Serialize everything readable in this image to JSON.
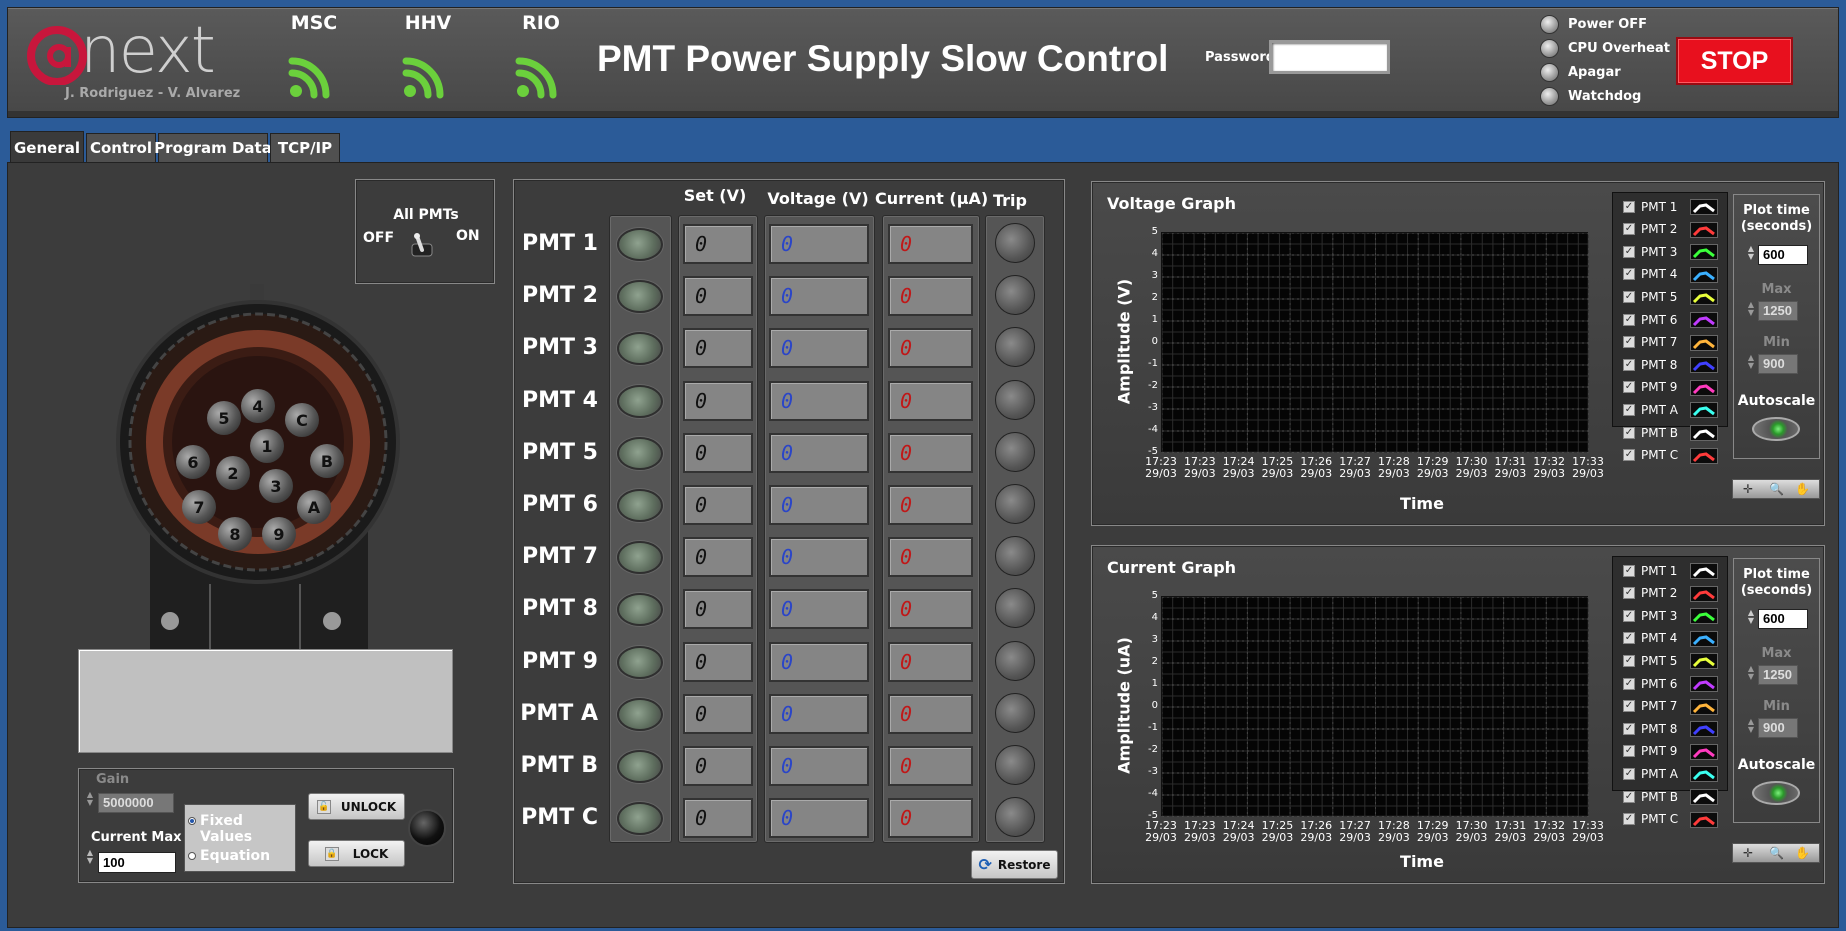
{
  "header": {
    "logo_text": "next",
    "authors": "J. Rodriguez  - V. Alvarez",
    "network": [
      "MSC",
      "HHV",
      "RIO"
    ],
    "title": "PMT Power Supply Slow Control",
    "password_label": "Password",
    "password_value": "",
    "status": [
      "Power OFF",
      "CPU Overheat",
      "Apagar",
      "Watchdog"
    ],
    "stop_label": "STOP",
    "colors": {
      "wifi": "#6bd03c",
      "stop": "#e8101e",
      "logo": "#c8163c"
    }
  },
  "tabs": [
    "General",
    "Control",
    "Program Data",
    "TCP/IP"
  ],
  "active_tab": "General",
  "all_pmts": {
    "title": "All PMTs",
    "off": "OFF",
    "on": "ON"
  },
  "pmt_numbers": [
    "1",
    "2",
    "3",
    "4",
    "5",
    "6",
    "7",
    "8",
    "9",
    "A",
    "B",
    "C"
  ],
  "gain": {
    "label": "Gain",
    "value": "5000000",
    "current_max_label": "Current Max",
    "current_max_value": "100",
    "fixed_values": "Fixed Values",
    "equation": "Equation",
    "selected": "Fixed Values",
    "unlock": "UNLOCK",
    "lock": "LOCK"
  },
  "pmt_table": {
    "headers": {
      "set": "Set (V)",
      "voltage": "Voltage (V)",
      "current": "Current  (µA)",
      "trip": "Trip"
    },
    "rows": [
      {
        "label": "PMT 1",
        "set": "0",
        "voltage": "0",
        "current": "0"
      },
      {
        "label": "PMT 2",
        "set": "0",
        "voltage": "0",
        "current": "0"
      },
      {
        "label": "PMT 3",
        "set": "0",
        "voltage": "0",
        "current": "0"
      },
      {
        "label": "PMT 4",
        "set": "0",
        "voltage": "0",
        "current": "0"
      },
      {
        "label": "PMT 5",
        "set": "0",
        "voltage": "0",
        "current": "0"
      },
      {
        "label": "PMT 6",
        "set": "0",
        "voltage": "0",
        "current": "0"
      },
      {
        "label": "PMT 7",
        "set": "0",
        "voltage": "0",
        "current": "0"
      },
      {
        "label": "PMT 8",
        "set": "0",
        "voltage": "0",
        "current": "0"
      },
      {
        "label": "PMT 9",
        "set": "0",
        "voltage": "0",
        "current": "0"
      },
      {
        "label": "PMT A",
        "set": "0",
        "voltage": "0",
        "current": "0"
      },
      {
        "label": "PMT B",
        "set": "0",
        "voltage": "0",
        "current": "0"
      },
      {
        "label": "PMT C",
        "set": "0",
        "voltage": "0",
        "current": "0"
      }
    ],
    "restore_label": "Restore"
  },
  "graphs": [
    {
      "title": "Voltage Graph",
      "ylabel": "Amplitude (V)",
      "xlabel": "Time"
    },
    {
      "title": "Current Graph",
      "ylabel": "Amplitude (uA)",
      "xlabel": "Time"
    }
  ],
  "plot_controls": {
    "plot_time_label": "Plot time (seconds)",
    "plot_time_value": "600",
    "max_label": "Max",
    "max_value": "1250",
    "min_label": "Min",
    "min_value": "900",
    "autoscale_label": "Autoscale"
  },
  "chart_data": [
    {
      "type": "line",
      "title": "Voltage Graph",
      "xlabel": "Time",
      "ylabel": "Amplitude (V)",
      "ylim": [
        -5,
        5
      ],
      "yticks": [
        "5",
        "4",
        "3",
        "2",
        "1",
        "0",
        "-1",
        "-2",
        "-3",
        "-4",
        "-5"
      ],
      "xticks": [
        "17:23\n29/03",
        "17:23\n29/03",
        "17:24\n29/03",
        "17:25\n29/03",
        "17:26\n29/03",
        "17:27\n29/03",
        "17:28\n29/03",
        "17:29\n29/03",
        "17:30\n29/03",
        "17:31\n29/03",
        "17:32\n29/03",
        "17:33\n29/03"
      ],
      "grid": true,
      "legend": "right",
      "series": [
        {
          "name": "PMT 1",
          "color": "#ffffff",
          "values": []
        },
        {
          "name": "PMT 2",
          "color": "#ff3b3b",
          "values": []
        },
        {
          "name": "PMT 3",
          "color": "#3bff3b",
          "values": []
        },
        {
          "name": "PMT 4",
          "color": "#3bb0ff",
          "values": []
        },
        {
          "name": "PMT 5",
          "color": "#e8ff3b",
          "values": []
        },
        {
          "name": "PMT 6",
          "color": "#c13bff",
          "values": []
        },
        {
          "name": "PMT 7",
          "color": "#ffb43b",
          "values": []
        },
        {
          "name": "PMT 8",
          "color": "#4040ff",
          "values": []
        },
        {
          "name": "PMT 9",
          "color": "#ff3bbf",
          "values": []
        },
        {
          "name": "PMT A",
          "color": "#3bfff0",
          "values": []
        },
        {
          "name": "PMT B",
          "color": "#ffffff",
          "values": []
        },
        {
          "name": "PMT C",
          "color": "#ff3b3b",
          "values": []
        }
      ]
    },
    {
      "type": "line",
      "title": "Current Graph",
      "xlabel": "Time",
      "ylabel": "Amplitude (uA)",
      "ylim": [
        -5,
        5
      ],
      "yticks": [
        "5",
        "4",
        "3",
        "2",
        "1",
        "0",
        "-1",
        "-2",
        "-3",
        "-4",
        "-5"
      ],
      "xticks": [
        "17:23\n29/03",
        "17:23\n29/03",
        "17:24\n29/03",
        "17:25\n29/03",
        "17:26\n29/03",
        "17:27\n29/03",
        "17:28\n29/03",
        "17:29\n29/03",
        "17:30\n29/03",
        "17:31\n29/03",
        "17:32\n29/03",
        "17:33\n29/03"
      ],
      "grid": true,
      "legend": "right",
      "series": [
        {
          "name": "PMT 1",
          "color": "#ffffff",
          "values": []
        },
        {
          "name": "PMT 2",
          "color": "#ff3b3b",
          "values": []
        },
        {
          "name": "PMT 3",
          "color": "#3bff3b",
          "values": []
        },
        {
          "name": "PMT 4",
          "color": "#3bb0ff",
          "values": []
        },
        {
          "name": "PMT 5",
          "color": "#e8ff3b",
          "values": []
        },
        {
          "name": "PMT 6",
          "color": "#c13bff",
          "values": []
        },
        {
          "name": "PMT 7",
          "color": "#ffb43b",
          "values": []
        },
        {
          "name": "PMT 8",
          "color": "#4040ff",
          "values": []
        },
        {
          "name": "PMT 9",
          "color": "#ff3bbf",
          "values": []
        },
        {
          "name": "PMT A",
          "color": "#3bfff0",
          "values": []
        },
        {
          "name": "PMT B",
          "color": "#ffffff",
          "values": []
        },
        {
          "name": "PMT C",
          "color": "#ff3b3b",
          "values": []
        }
      ]
    }
  ]
}
